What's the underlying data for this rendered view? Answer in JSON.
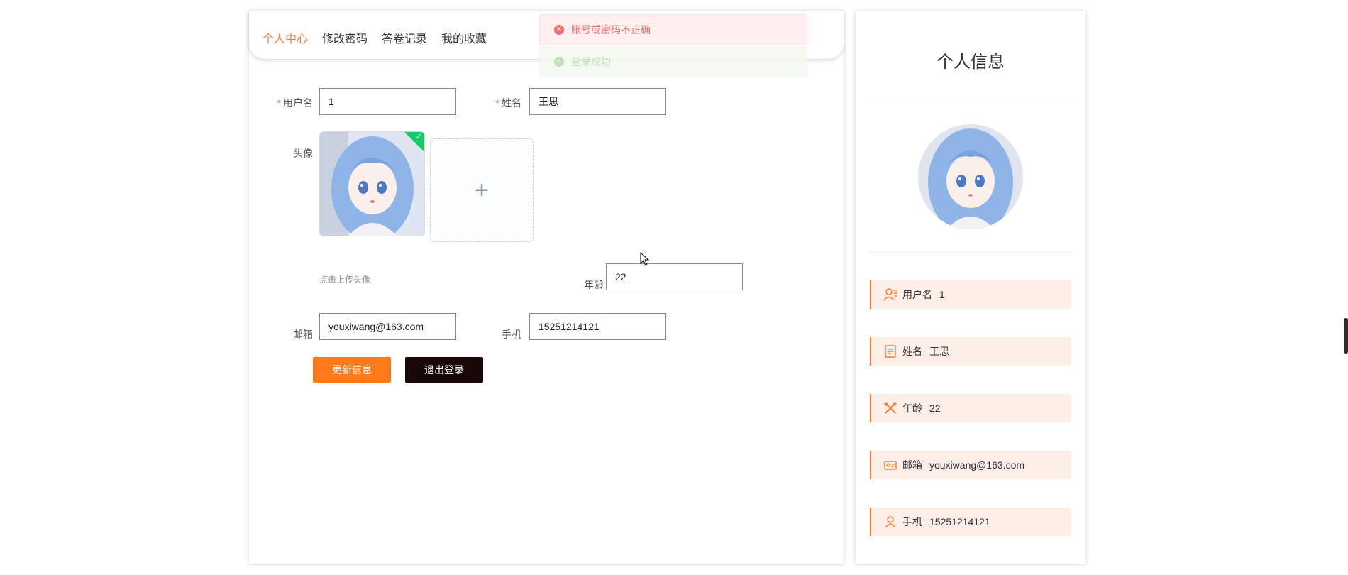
{
  "tabs": [
    {
      "label": "个人中心",
      "active": true
    },
    {
      "label": "修改密码",
      "active": false
    },
    {
      "label": "答卷记录",
      "active": false
    },
    {
      "label": "我的收藏",
      "active": false
    }
  ],
  "toasts": {
    "error": "账号或密码不正确",
    "success": "登录成功"
  },
  "form": {
    "username_label": "用户名",
    "username_value": "1",
    "name_label": "姓名",
    "name_value": "王思",
    "avatar_label": "头像",
    "upload_hint": "点击上传头像",
    "age_label": "年龄",
    "age_value": "22",
    "email_label": "邮箱",
    "email_value": "youxiwang@163.com",
    "phone_label": "手机",
    "phone_value": "15251214121",
    "required_mark": "*"
  },
  "buttons": {
    "update": "更新信息",
    "logout": "退出登录"
  },
  "info": {
    "title": "个人信息",
    "rows": [
      {
        "label": "用户名",
        "value": "1",
        "icon": "user-group-icon"
      },
      {
        "label": "姓名",
        "value": "王思",
        "icon": "document-icon"
      },
      {
        "label": "年龄",
        "value": "22",
        "icon": "tools-icon"
      },
      {
        "label": "邮箱",
        "value": "youxiwang@163.com",
        "icon": "id-card-icon"
      },
      {
        "label": "手机",
        "value": "15251214121",
        "icon": "user-icon"
      }
    ]
  },
  "colors": {
    "accent": "#ff7a2a",
    "update_button": "#ff7a1a",
    "logout_button": "#1a0808",
    "error": "#f56c6c",
    "success": "#13ce66",
    "info_row_bg": "#fdeee8"
  }
}
